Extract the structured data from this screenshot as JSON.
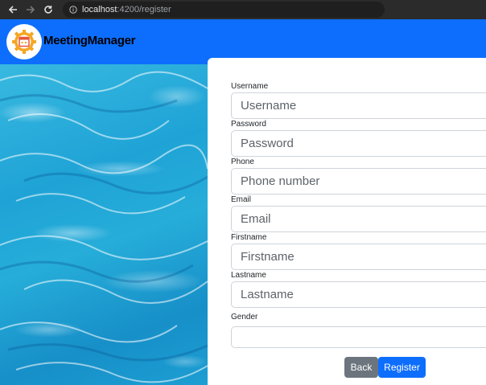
{
  "browser": {
    "url_host": "localhost",
    "url_path": ":4200/register"
  },
  "header": {
    "brand": "MeetingManager",
    "logo_icon": "gear-calendar-logo",
    "bg_color": "#0d6efd"
  },
  "form": {
    "fields": [
      {
        "label": "Username",
        "placeholder": "Username",
        "value": ""
      },
      {
        "label": "Password",
        "placeholder": "Password",
        "value": ""
      },
      {
        "label": "Phone",
        "placeholder": "Phone number",
        "value": ""
      },
      {
        "label": "Email",
        "placeholder": "Email",
        "value": ""
      },
      {
        "label": "Firstname",
        "placeholder": "Firstname",
        "value": ""
      },
      {
        "label": "Lastname",
        "placeholder": "Lastname",
        "value": ""
      }
    ],
    "gender": {
      "label": "Gender",
      "value": ""
    },
    "back_label": "Back",
    "register_label": "Register"
  }
}
